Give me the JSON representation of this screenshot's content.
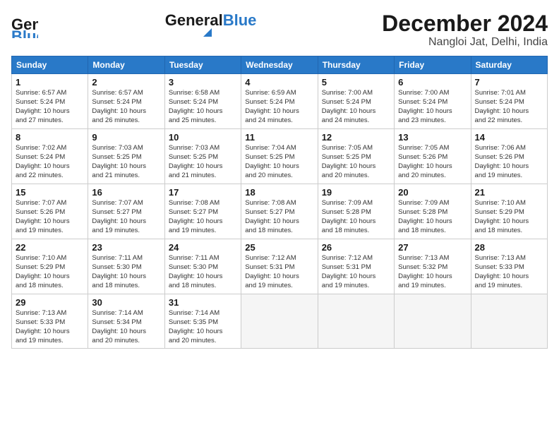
{
  "header": {
    "logo_line1": "General",
    "logo_line2": "Blue",
    "month_title": "December 2024",
    "location": "Nangloi Jat, Delhi, India"
  },
  "calendar": {
    "days_of_week": [
      "Sunday",
      "Monday",
      "Tuesday",
      "Wednesday",
      "Thursday",
      "Friday",
      "Saturday"
    ],
    "weeks": [
      [
        {
          "day": "1",
          "info": "Sunrise: 6:57 AM\nSunset: 5:24 PM\nDaylight: 10 hours\nand 27 minutes."
        },
        {
          "day": "2",
          "info": "Sunrise: 6:57 AM\nSunset: 5:24 PM\nDaylight: 10 hours\nand 26 minutes."
        },
        {
          "day": "3",
          "info": "Sunrise: 6:58 AM\nSunset: 5:24 PM\nDaylight: 10 hours\nand 25 minutes."
        },
        {
          "day": "4",
          "info": "Sunrise: 6:59 AM\nSunset: 5:24 PM\nDaylight: 10 hours\nand 24 minutes."
        },
        {
          "day": "5",
          "info": "Sunrise: 7:00 AM\nSunset: 5:24 PM\nDaylight: 10 hours\nand 24 minutes."
        },
        {
          "day": "6",
          "info": "Sunrise: 7:00 AM\nSunset: 5:24 PM\nDaylight: 10 hours\nand 23 minutes."
        },
        {
          "day": "7",
          "info": "Sunrise: 7:01 AM\nSunset: 5:24 PM\nDaylight: 10 hours\nand 22 minutes."
        }
      ],
      [
        {
          "day": "8",
          "info": "Sunrise: 7:02 AM\nSunset: 5:24 PM\nDaylight: 10 hours\nand 22 minutes."
        },
        {
          "day": "9",
          "info": "Sunrise: 7:03 AM\nSunset: 5:25 PM\nDaylight: 10 hours\nand 21 minutes."
        },
        {
          "day": "10",
          "info": "Sunrise: 7:03 AM\nSunset: 5:25 PM\nDaylight: 10 hours\nand 21 minutes."
        },
        {
          "day": "11",
          "info": "Sunrise: 7:04 AM\nSunset: 5:25 PM\nDaylight: 10 hours\nand 20 minutes."
        },
        {
          "day": "12",
          "info": "Sunrise: 7:05 AM\nSunset: 5:25 PM\nDaylight: 10 hours\nand 20 minutes."
        },
        {
          "day": "13",
          "info": "Sunrise: 7:05 AM\nSunset: 5:26 PM\nDaylight: 10 hours\nand 20 minutes."
        },
        {
          "day": "14",
          "info": "Sunrise: 7:06 AM\nSunset: 5:26 PM\nDaylight: 10 hours\nand 19 minutes."
        }
      ],
      [
        {
          "day": "15",
          "info": "Sunrise: 7:07 AM\nSunset: 5:26 PM\nDaylight: 10 hours\nand 19 minutes."
        },
        {
          "day": "16",
          "info": "Sunrise: 7:07 AM\nSunset: 5:27 PM\nDaylight: 10 hours\nand 19 minutes."
        },
        {
          "day": "17",
          "info": "Sunrise: 7:08 AM\nSunset: 5:27 PM\nDaylight: 10 hours\nand 19 minutes."
        },
        {
          "day": "18",
          "info": "Sunrise: 7:08 AM\nSunset: 5:27 PM\nDaylight: 10 hours\nand 18 minutes."
        },
        {
          "day": "19",
          "info": "Sunrise: 7:09 AM\nSunset: 5:28 PM\nDaylight: 10 hours\nand 18 minutes."
        },
        {
          "day": "20",
          "info": "Sunrise: 7:09 AM\nSunset: 5:28 PM\nDaylight: 10 hours\nand 18 minutes."
        },
        {
          "day": "21",
          "info": "Sunrise: 7:10 AM\nSunset: 5:29 PM\nDaylight: 10 hours\nand 18 minutes."
        }
      ],
      [
        {
          "day": "22",
          "info": "Sunrise: 7:10 AM\nSunset: 5:29 PM\nDaylight: 10 hours\nand 18 minutes."
        },
        {
          "day": "23",
          "info": "Sunrise: 7:11 AM\nSunset: 5:30 PM\nDaylight: 10 hours\nand 18 minutes."
        },
        {
          "day": "24",
          "info": "Sunrise: 7:11 AM\nSunset: 5:30 PM\nDaylight: 10 hours\nand 18 minutes."
        },
        {
          "day": "25",
          "info": "Sunrise: 7:12 AM\nSunset: 5:31 PM\nDaylight: 10 hours\nand 19 minutes."
        },
        {
          "day": "26",
          "info": "Sunrise: 7:12 AM\nSunset: 5:31 PM\nDaylight: 10 hours\nand 19 minutes."
        },
        {
          "day": "27",
          "info": "Sunrise: 7:13 AM\nSunset: 5:32 PM\nDaylight: 10 hours\nand 19 minutes."
        },
        {
          "day": "28",
          "info": "Sunrise: 7:13 AM\nSunset: 5:33 PM\nDaylight: 10 hours\nand 19 minutes."
        }
      ],
      [
        {
          "day": "29",
          "info": "Sunrise: 7:13 AM\nSunset: 5:33 PM\nDaylight: 10 hours\nand 19 minutes."
        },
        {
          "day": "30",
          "info": "Sunrise: 7:14 AM\nSunset: 5:34 PM\nDaylight: 10 hours\nand 20 minutes."
        },
        {
          "day": "31",
          "info": "Sunrise: 7:14 AM\nSunset: 5:35 PM\nDaylight: 10 hours\nand 20 minutes."
        },
        {
          "day": "",
          "info": ""
        },
        {
          "day": "",
          "info": ""
        },
        {
          "day": "",
          "info": ""
        },
        {
          "day": "",
          "info": ""
        }
      ]
    ]
  }
}
